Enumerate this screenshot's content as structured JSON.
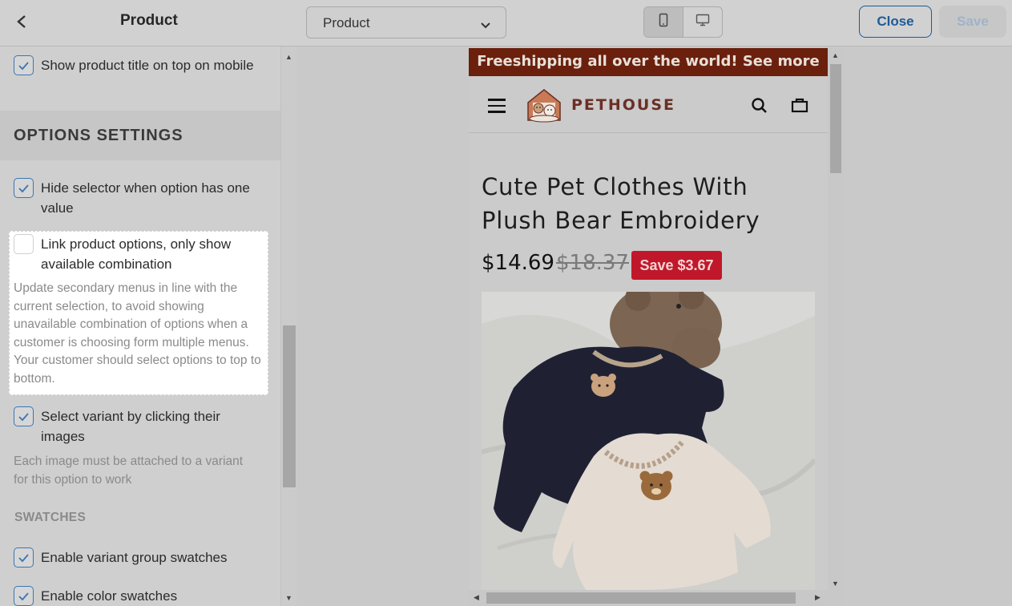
{
  "topbar": {
    "title": "Product",
    "page_select": "Product",
    "close_label": "Close",
    "save_label": "Save"
  },
  "sidebar": {
    "show_title_mobile": "Show product title on top on mobile",
    "section_title": "OPTIONS SETTINGS",
    "options": {
      "hide_selector": {
        "label": "Hide selector when option has one value",
        "checked": true
      },
      "link_options": {
        "label": "Link product options, only show available combination",
        "checked": false,
        "help": "Update secondary menus in line with the current selection, to avoid showing unavailable combination of options when a customer is choosing form multiple menus. Your customer should select options to top to bottom."
      },
      "select_variant_images": {
        "label": "Select variant by clicking their images",
        "checked": true,
        "help": "Each image must be attached to a variant for this option to work"
      }
    },
    "swatches_heading": "SWATCHES",
    "swatches": {
      "variant_group": {
        "label": "Enable variant group swatches",
        "checked": true
      },
      "color": {
        "label": "Enable color swatches",
        "checked": true
      }
    }
  },
  "preview": {
    "announcement": "Freeshipping all over the world! See more",
    "logo_text": "PETHOUSE",
    "product_title": "Cute Pet Clothes With Plush Bear Embroidery",
    "price": "$14.69",
    "compare_price": "$18.37",
    "save_badge": "Save $3.67"
  },
  "colors": {
    "accent": "#1d5a96",
    "announcement_bg": "#6a200d",
    "sale_badge": "#c0182a"
  }
}
